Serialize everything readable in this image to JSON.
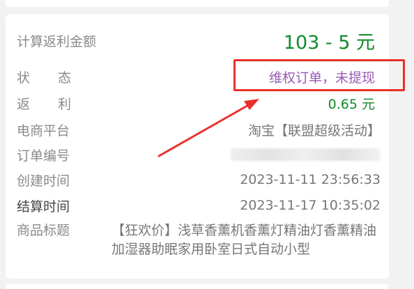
{
  "rebate": {
    "calc_label": "计算返利金额",
    "calc_value": "103 - 5 元",
    "status_label_1": "状",
    "status_label_2": "态",
    "status_value": "维权订单，未提现",
    "rebate_label_1": "返",
    "rebate_label_2": "利",
    "rebate_value": "0.65 元",
    "platform_label": "电商平台",
    "platform_value": "淘宝【联盟超级活动】",
    "order_label": "订单编号",
    "created_label": "创建时间",
    "created_value": "2023-11-11 23:56:33",
    "settled_label": "结算时间",
    "settled_value": "2023-11-17 10:35:02",
    "product_label": "商品标题",
    "product_value": "【狂欢价】浅草香薰机香薰灯精油灯香薰精油加湿器助眠家用卧室日式自动小型"
  },
  "colors": {
    "accent_green": "#0f8a2a",
    "status_purple": "#9b59b6",
    "annotation_red": "#e8302a"
  }
}
